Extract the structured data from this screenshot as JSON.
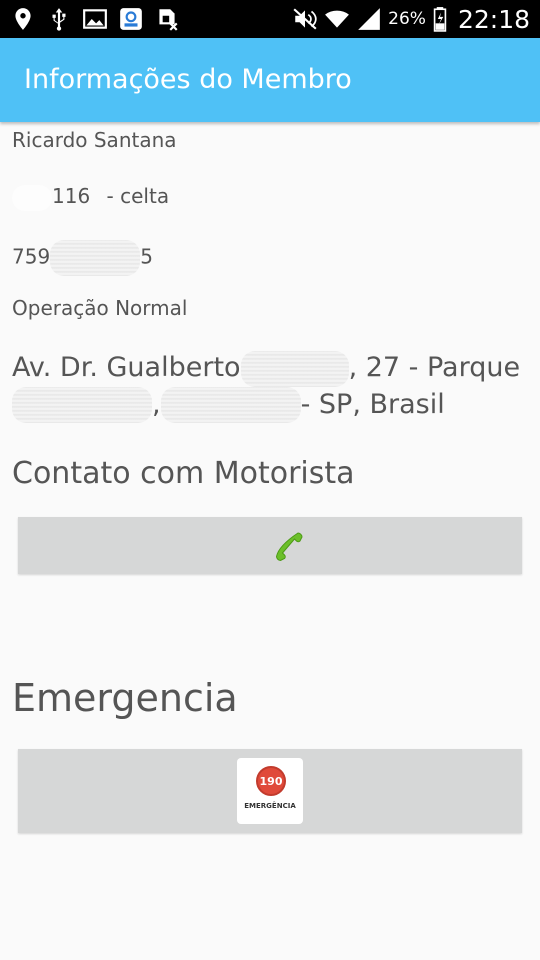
{
  "status_bar": {
    "battery": "26%",
    "time": "22:18"
  },
  "app_bar": {
    "title": "Informações do Membro"
  },
  "member": {
    "name": "Ricardo Santana",
    "vehicle_visible": "116",
    "vehicle_suffix": "- celta",
    "phone_prefix": "759",
    "phone_suffix": "5",
    "status": "Operação Normal",
    "address_part1": "Av. Dr. Gualberto",
    "address_part2": ", 27 - Parque",
    "address_part3": ",",
    "address_part4": "- SP, Brasil"
  },
  "sections": {
    "contact_title": "Contato com Motorista",
    "emergency_title": "Emergencia"
  },
  "emergency_badge": {
    "number": "190",
    "label": "EMERGÊNCIA"
  },
  "colors": {
    "app_bar": "#4fc1f6",
    "button": "#d6d7d7",
    "phone_icon": "#6cbf2a",
    "emergency_red": "#e04a3a"
  },
  "icons": [
    "location-icon",
    "usb-icon",
    "image-icon",
    "nfc-app-icon",
    "sim-off-icon",
    "mute-icon",
    "wifi-icon",
    "signal-icon",
    "battery-icon",
    "phone-icon"
  ]
}
